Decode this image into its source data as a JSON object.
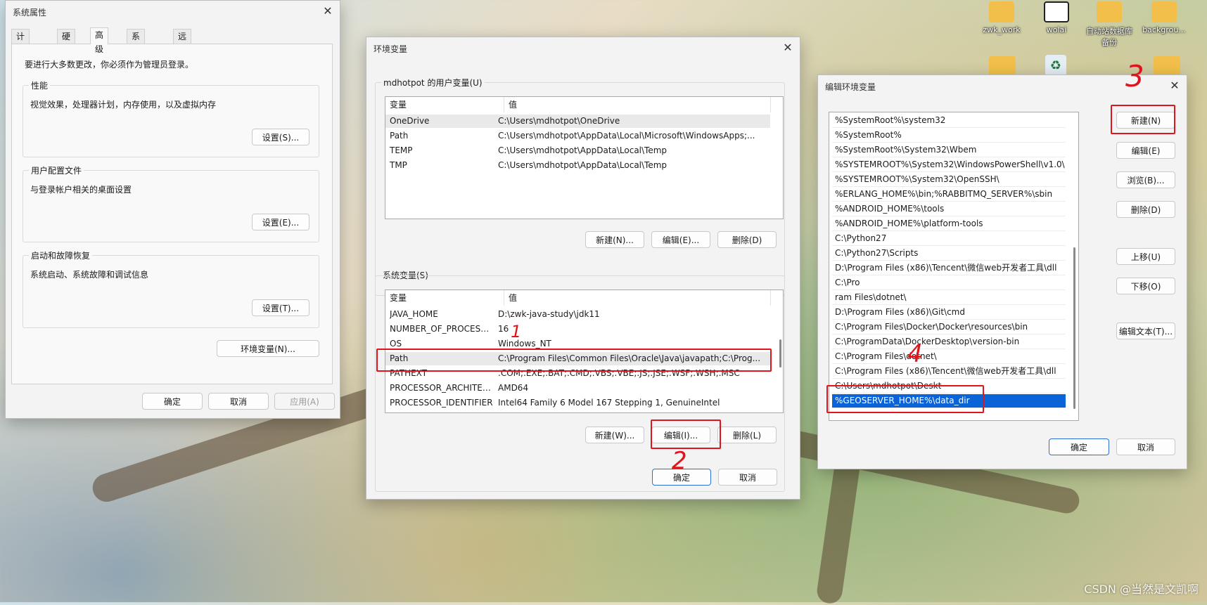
{
  "desktop": {
    "icons": [
      "zwk_work",
      "wolai",
      "自动站数据库备份",
      "backgrou..."
    ],
    "watermark": "CSDN @当然是文凯啊"
  },
  "sysprops": {
    "title": "系统属性",
    "tabs": [
      "计算机名",
      "硬件",
      "高级",
      "系统保护",
      "远程"
    ],
    "active_tab": "高级",
    "admin_note": "要进行大多数更改，你必须作为管理员登录。",
    "perf_label": "性能",
    "perf_desc": "视觉效果，处理器计划，内存使用，以及虚拟内存",
    "perf_btn": "设置(S)...",
    "profile_label": "用户配置文件",
    "profile_desc": "与登录帐户相关的桌面设置",
    "profile_btn": "设置(E)...",
    "startup_label": "启动和故障恢复",
    "startup_desc": "系统启动、系统故障和调试信息",
    "startup_btn": "设置(T)...",
    "env_btn": "环境变量(N)...",
    "ok": "确定",
    "cancel": "取消",
    "apply": "应用(A)"
  },
  "envvars": {
    "title": "环境变量",
    "user_group": "mdhotpot 的用户变量(U)",
    "col_var": "变量",
    "col_val": "值",
    "user_rows": [
      {
        "name": "OneDrive",
        "value": "C:\\Users\\mdhotpot\\OneDrive"
      },
      {
        "name": "Path",
        "value": "C:\\Users\\mdhotpot\\AppData\\Local\\Microsoft\\WindowsApps;..."
      },
      {
        "name": "TEMP",
        "value": "C:\\Users\\mdhotpot\\AppData\\Local\\Temp"
      },
      {
        "name": "TMP",
        "value": "C:\\Users\\mdhotpot\\AppData\\Local\\Temp"
      }
    ],
    "user_new": "新建(N)...",
    "user_edit": "编辑(E)...",
    "user_delete": "删除(D)",
    "sys_group": "系统变量(S)",
    "sys_rows": [
      {
        "name": "JAVA_HOME",
        "value": "D:\\zwk-java-study\\jdk11"
      },
      {
        "name": "NUMBER_OF_PROCESSORS",
        "value": "16"
      },
      {
        "name": "OS",
        "value": "Windows_NT"
      },
      {
        "name": "Path",
        "value": "C:\\Program Files\\Common Files\\Oracle\\Java\\javapath;C:\\Prog..."
      },
      {
        "name": "PATHEXT",
        "value": ".COM;.EXE;.BAT;.CMD;.VBS;.VBE;.JS;.JSE;.WSF;.WSH;.MSC"
      },
      {
        "name": "PROCESSOR_ARCHITECT...",
        "value": "AMD64"
      },
      {
        "name": "PROCESSOR_IDENTIFIER",
        "value": "Intel64 Family 6 Model 167 Stepping 1, GenuineIntel"
      }
    ],
    "sys_new": "新建(W)...",
    "sys_edit": "编辑(I)...",
    "sys_delete": "删除(L)",
    "ok": "确定",
    "cancel": "取消"
  },
  "editenv": {
    "title": "编辑环境变量",
    "items": [
      "%SystemRoot%\\system32",
      "%SystemRoot%",
      "%SystemRoot%\\System32\\Wbem",
      "%SYSTEMROOT%\\System32\\WindowsPowerShell\\v1.0\\",
      "%SYSTEMROOT%\\System32\\OpenSSH\\",
      "%ERLANG_HOME%\\bin;%RABBITMQ_SERVER%\\sbin",
      "%ANDROID_HOME%\\tools",
      "%ANDROID_HOME%\\platform-tools",
      "C:\\Python27",
      "C:\\Python27\\Scripts",
      "D:\\Program Files (x86)\\Tencent\\微信web开发者工具\\dll",
      "C:\\Pro",
      "ram Files\\dotnet\\",
      "D:\\Program Files (x86)\\Git\\cmd",
      "C:\\Program Files\\Docker\\Docker\\resources\\bin",
      "C:\\ProgramData\\DockerDesktop\\version-bin",
      "C:\\Program Files\\dotnet\\",
      "C:\\Program Files (x86)\\Tencent\\微信web开发者工具\\dll",
      "C:\\Users\\mdhotpot\\Deskt",
      "%GEOSERVER_HOME%\\data_dir"
    ],
    "selected_index": 19,
    "new": "新建(N)",
    "edit": "编辑(E)",
    "browse": "浏览(B)...",
    "delete": "删除(D)",
    "move_up": "上移(U)",
    "move_down": "下移(O)",
    "edit_text": "编辑文本(T)...",
    "ok": "确定",
    "cancel": "取消"
  },
  "annotations": {
    "step1": "1",
    "step2": "2",
    "step3": "3",
    "step4": "4",
    "color": "#e0141c"
  }
}
